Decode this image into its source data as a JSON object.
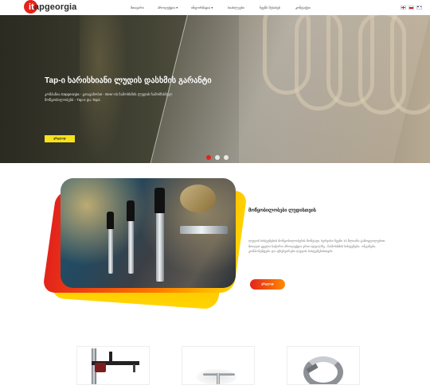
{
  "header": {
    "logo_prefix": "it",
    "logo_suffix": "apgeorgia",
    "nav": [
      {
        "label": "მთავარი"
      },
      {
        "label": "პროდუქცია ▾"
      },
      {
        "label": "ინფორმაცია ▾"
      },
      {
        "label": "სიახლეები"
      },
      {
        "label": "ჩვენს შესახებ"
      },
      {
        "label": "კონტაქტი"
      }
    ],
    "flags": [
      "georgia-flag",
      "russia-flag",
      "uk-flag"
    ]
  },
  "hero": {
    "title": "Tap-ი ხარისხიანი ლუდის დასხმის გარანტი",
    "description": "კომპანია Itapgeorgia - გთავაზობთ - Beer-ის ჩამოსხმის ლუდის ჩამომსხმელ მოწყობილობებს - Tap-ი და Tap2.",
    "button": "ვრცლად",
    "slide_count": 3,
    "active_slide": 1
  },
  "feature": {
    "title": "მოწყობილობები ლუდისთვის",
    "text": "ლუდის სისტემების მოწყობილობების მონტაჟი, სერვისი ჩვენი 10 წლიანი გამოცდილებით. მიიღეთ ყველა საჭირო პროდუქცია ერთ ადგილზე - ჩამოსხმის სისტემები, ონკანები, კომპონენტები და აქსესუარები ლუდის სისტემებისთვის.",
    "button": "ვრცლად"
  },
  "products": [
    {
      "name": "tap-tower-product"
    },
    {
      "name": "tap-faucet-product"
    },
    {
      "name": "hose-clamp-product"
    }
  ]
}
